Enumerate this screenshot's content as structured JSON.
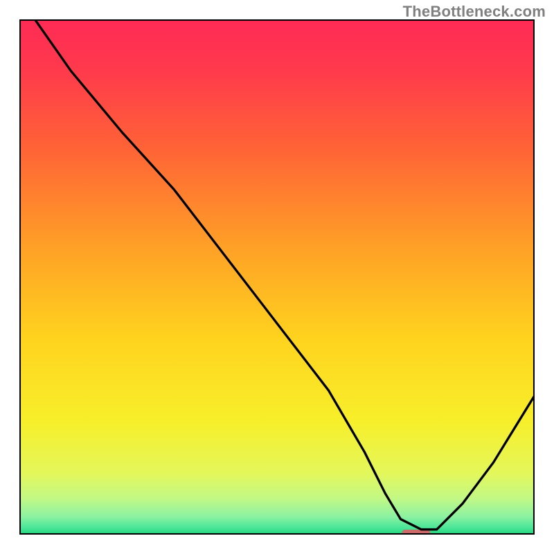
{
  "watermark": "TheBottleneck.com",
  "chart_data": {
    "type": "line",
    "title": "",
    "xlabel": "",
    "ylabel": "",
    "xlim": [
      0,
      100
    ],
    "ylim": [
      0,
      100
    ],
    "grid": false,
    "series": [
      {
        "name": "curve",
        "x": [
          3,
          10,
          20,
          30,
          40,
          50,
          60,
          67,
          71,
          74,
          78,
          81,
          86,
          92,
          100
        ],
        "y": [
          100,
          90,
          78,
          67,
          54,
          41,
          28,
          16,
          8,
          3,
          1,
          1,
          6,
          14,
          27
        ]
      }
    ],
    "highlight_marker": {
      "x": 77,
      "y": 0.3,
      "w": 5.5,
      "h": 1.3
    },
    "gradient_stops": [
      {
        "offset": 0.0,
        "color": "#ff2a55"
      },
      {
        "offset": 0.1,
        "color": "#ff3a4c"
      },
      {
        "offset": 0.25,
        "color": "#ff6336"
      },
      {
        "offset": 0.45,
        "color": "#ffa326"
      },
      {
        "offset": 0.62,
        "color": "#ffd31e"
      },
      {
        "offset": 0.78,
        "color": "#f7ef2a"
      },
      {
        "offset": 0.88,
        "color": "#e4f75a"
      },
      {
        "offset": 0.93,
        "color": "#c2f885"
      },
      {
        "offset": 0.965,
        "color": "#8cf2a1"
      },
      {
        "offset": 0.985,
        "color": "#4fe79a"
      },
      {
        "offset": 1.0,
        "color": "#1fd87d"
      }
    ],
    "border_color": "#000000",
    "line_color": "#000000",
    "marker_color": "#cf6a6a"
  }
}
